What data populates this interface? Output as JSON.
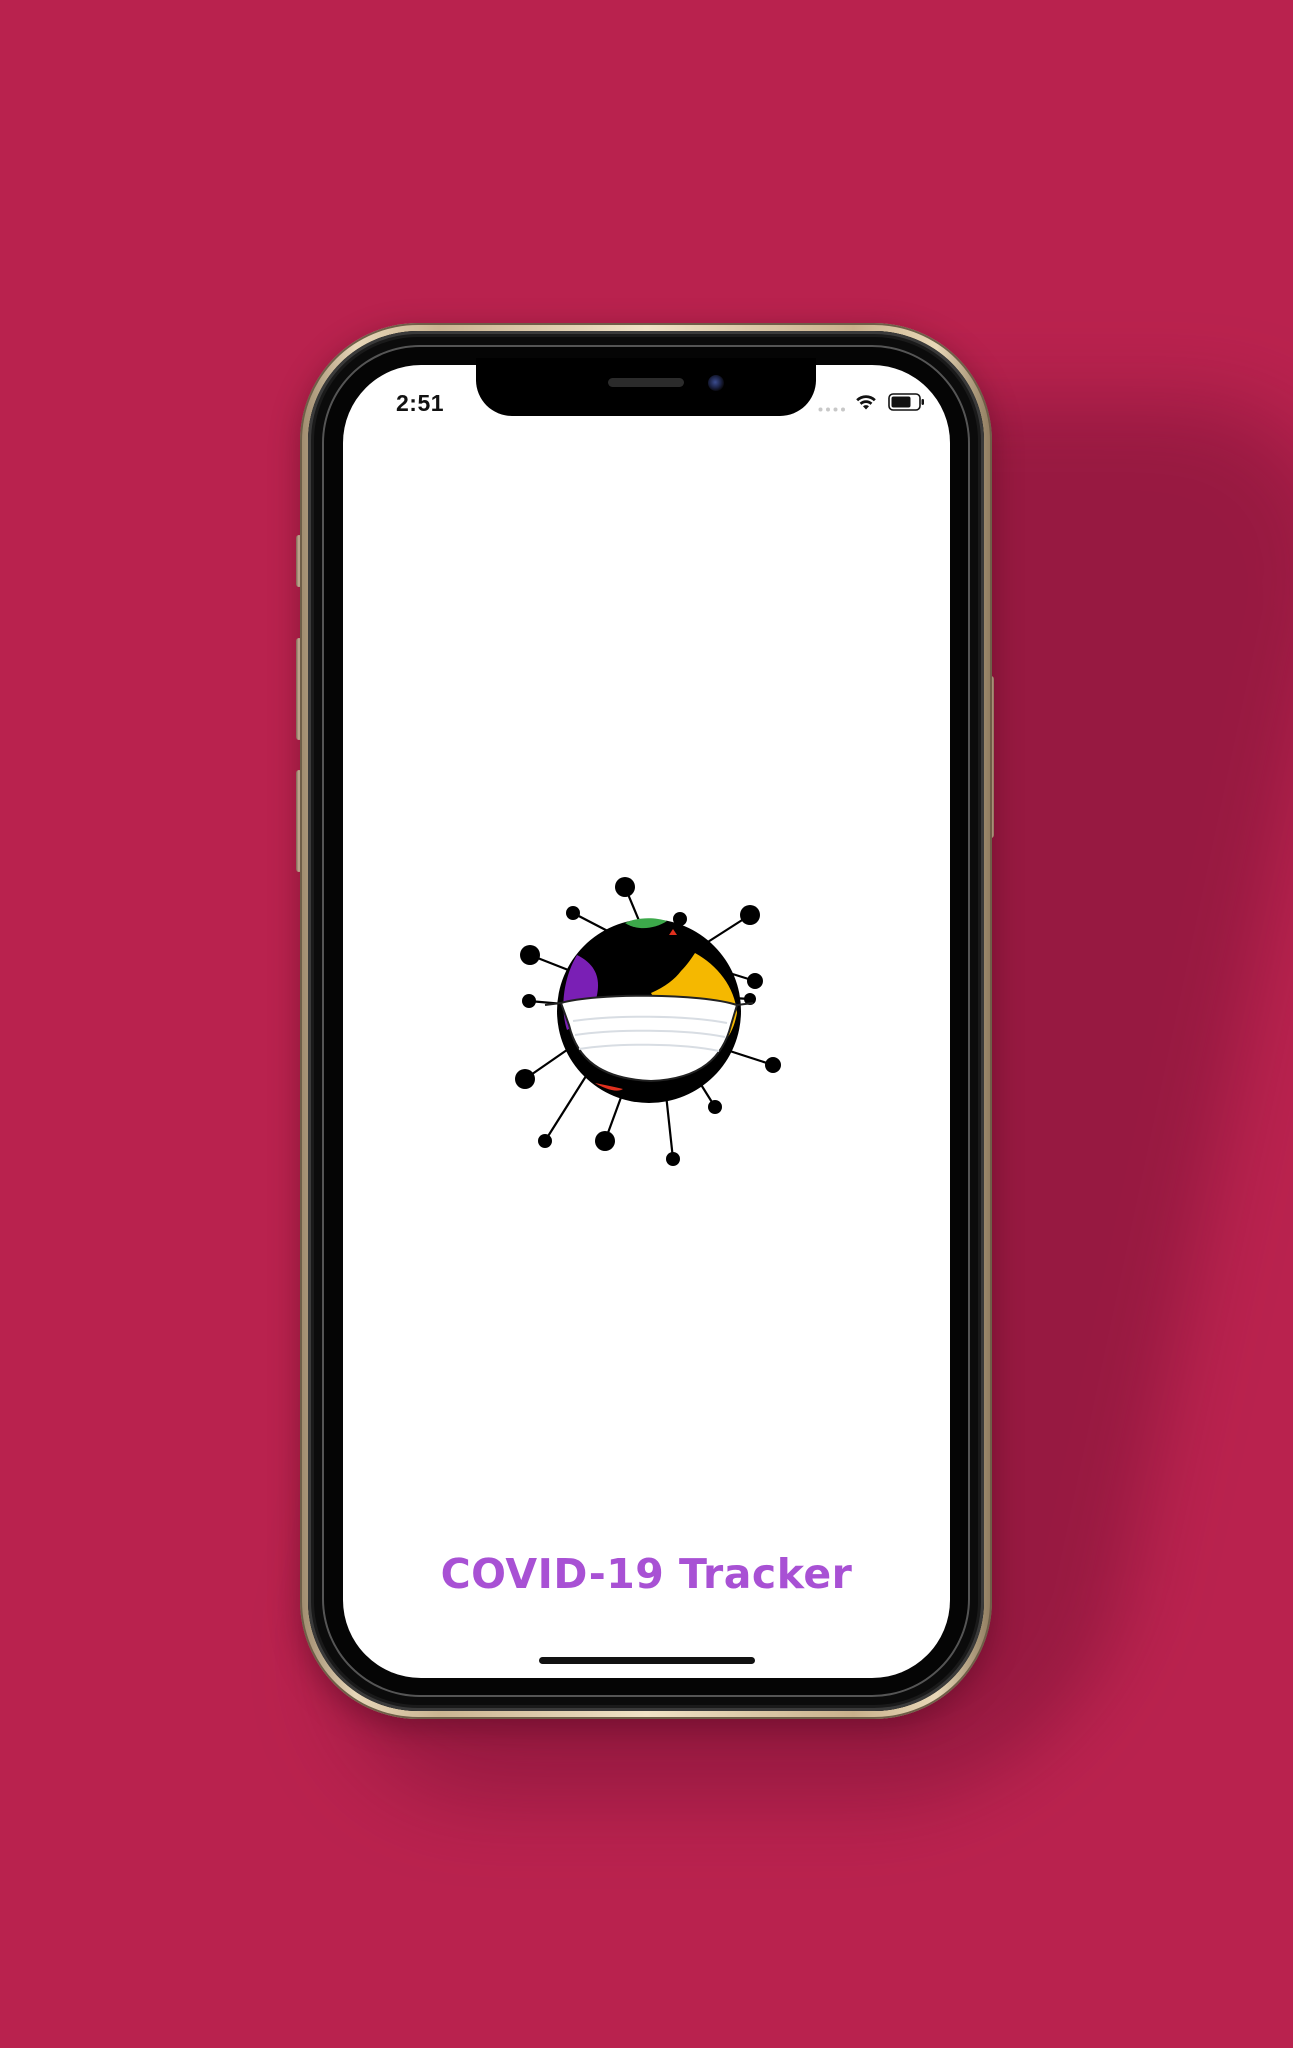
{
  "background_color": "#b9224e",
  "status_bar": {
    "time": "2:51",
    "icons": [
      "cellular-signal-icon",
      "wifi-icon",
      "battery-icon"
    ]
  },
  "app": {
    "logo_icon": "globe-virus-mask-icon",
    "title": "COVID-19 Tracker",
    "title_color": "#a851d4"
  }
}
